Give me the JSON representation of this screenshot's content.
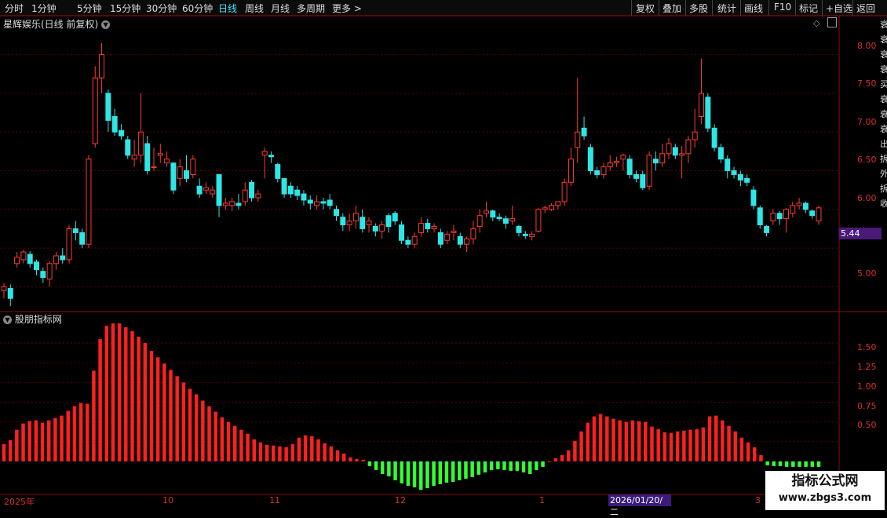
{
  "toolbar": {
    "periods": [
      "分时",
      "1分钟",
      "5分钟",
      "15分钟",
      "30分钟",
      "60分钟",
      "日线",
      "周线",
      "月线",
      "多周期",
      "更多 >"
    ],
    "active_period": "日线",
    "actions": [
      "复权",
      "叠加",
      "多股",
      "统计",
      "画线",
      "F10",
      "标记",
      "+自选",
      "返回"
    ]
  },
  "chart": {
    "title": "星辉娱乐(日线 前复权)",
    "indicator_title": "股朋指标网",
    "price_ticks": [
      "8.00",
      "7.50",
      "7.00",
      "6.50",
      "6.00",
      "5.00"
    ],
    "last_price_tag": "5.44",
    "indicator_ticks": [
      "1.50",
      "1.25",
      "1.00",
      "0.75",
      "0.50"
    ],
    "dates": [
      "2025年",
      "10",
      "11",
      "12",
      "1",
      "3"
    ],
    "highlighted_date": "2026/01/20/二",
    "colors": {
      "up": "#ff3b30",
      "down": "#2ee6e6",
      "macd_up": "#ff2020",
      "macd_down": "#33ff33",
      "grid": "#5a0000"
    }
  },
  "right_strip": "衰衰衰衰买衰衰衰出拆外拆收",
  "watermark": {
    "line1": "指标公式网",
    "line2": "www.zbgs3.com"
  },
  "chart_data": {
    "type": "candlestick",
    "title": "星辉娱乐(日线 前复权)",
    "price_range": [
      4.7,
      8.3
    ],
    "candles": [
      [
        4.95,
        5.0,
        4.85,
        5.05
      ],
      [
        4.98,
        4.85,
        4.75,
        5.03
      ],
      [
        5.3,
        5.38,
        5.25,
        5.45
      ],
      [
        5.35,
        5.45,
        5.3,
        5.48
      ],
      [
        5.42,
        5.3,
        5.25,
        5.46
      ],
      [
        5.32,
        5.22,
        5.15,
        5.35
      ],
      [
        5.2,
        5.12,
        5.05,
        5.25
      ],
      [
        5.1,
        5.3,
        5.0,
        5.33
      ],
      [
        5.3,
        5.4,
        5.22,
        5.45
      ],
      [
        5.4,
        5.35,
        5.3,
        5.5
      ],
      [
        5.35,
        5.75,
        5.3,
        5.8
      ],
      [
        5.75,
        5.7,
        5.6,
        5.85
      ],
      [
        5.7,
        5.55,
        5.5,
        5.75
      ],
      [
        5.55,
        6.65,
        5.5,
        6.7
      ],
      [
        6.85,
        7.7,
        6.8,
        7.85
      ],
      [
        7.7,
        8.0,
        7.5,
        8.15
      ],
      [
        7.5,
        7.15,
        7.0,
        7.55
      ],
      [
        7.2,
        7.0,
        6.95,
        7.3
      ],
      [
        7.02,
        6.95,
        6.9,
        7.1
      ],
      [
        6.9,
        6.7,
        6.65,
        6.95
      ],
      [
        6.65,
        6.7,
        6.55,
        6.9
      ],
      [
        6.7,
        7.0,
        6.6,
        7.5
      ],
      [
        6.85,
        6.5,
        6.45,
        6.95
      ],
      [
        6.55,
        6.55,
        6.5,
        6.8
      ],
      [
        6.7,
        6.72,
        6.6,
        6.85
      ],
      [
        6.6,
        6.65,
        6.55,
        6.75
      ],
      [
        6.6,
        6.25,
        6.2,
        6.6
      ],
      [
        6.4,
        6.55,
        6.3,
        6.65
      ],
      [
        6.5,
        6.4,
        6.35,
        6.7
      ],
      [
        6.45,
        6.65,
        6.4,
        6.7
      ],
      [
        6.3,
        6.2,
        6.15,
        6.4
      ],
      [
        6.25,
        6.28,
        6.2,
        6.35
      ],
      [
        6.2,
        6.25,
        6.15,
        6.3
      ],
      [
        6.45,
        6.05,
        5.9,
        6.45
      ],
      [
        6.05,
        6.08,
        6.0,
        6.15
      ],
      [
        6.05,
        6.1,
        5.98,
        6.15
      ],
      [
        6.08,
        6.05,
        6.0,
        6.2
      ],
      [
        6.1,
        6.25,
        6.05,
        6.35
      ],
      [
        6.35,
        6.15,
        6.1,
        6.38
      ],
      [
        6.15,
        6.2,
        6.1,
        6.25
      ],
      [
        6.7,
        6.75,
        6.4,
        6.8
      ],
      [
        6.7,
        6.68,
        6.6,
        6.75
      ],
      [
        6.58,
        6.4,
        6.35,
        6.6
      ],
      [
        6.4,
        6.2,
        6.15,
        6.4
      ],
      [
        6.3,
        6.2,
        6.15,
        6.35
      ],
      [
        6.25,
        6.18,
        6.12,
        6.3
      ],
      [
        6.2,
        6.12,
        6.05,
        6.25
      ],
      [
        6.12,
        6.08,
        6.0,
        6.18
      ],
      [
        6.05,
        6.1,
        6.0,
        6.18
      ],
      [
        6.1,
        6.08,
        6.0,
        6.15
      ],
      [
        6.12,
        6.05,
        6.0,
        6.2
      ],
      [
        6.0,
        5.92,
        5.85,
        6.05
      ],
      [
        5.9,
        5.8,
        5.72,
        5.95
      ],
      [
        5.8,
        5.85,
        5.72,
        5.95
      ],
      [
        5.85,
        5.95,
        5.75,
        6.05
      ],
      [
        5.9,
        5.75,
        5.7,
        6.0
      ],
      [
        5.8,
        5.85,
        5.7,
        5.9
      ],
      [
        5.78,
        5.72,
        5.65,
        5.82
      ],
      [
        5.72,
        5.8,
        5.62,
        5.85
      ],
      [
        5.92,
        5.78,
        5.7,
        5.95
      ],
      [
        5.95,
        5.85,
        5.8,
        5.98
      ],
      [
        5.8,
        5.6,
        5.55,
        5.85
      ],
      [
        5.6,
        5.55,
        5.5,
        5.65
      ],
      [
        5.55,
        5.65,
        5.5,
        5.7
      ],
      [
        5.7,
        5.82,
        5.65,
        5.9
      ],
      [
        5.82,
        5.75,
        5.7,
        5.88
      ],
      [
        5.75,
        5.78,
        5.7,
        5.82
      ],
      [
        5.7,
        5.55,
        5.5,
        5.75
      ],
      [
        5.6,
        5.68,
        5.55,
        5.72
      ],
      [
        5.7,
        5.72,
        5.6,
        5.8
      ],
      [
        5.65,
        5.55,
        5.5,
        5.7
      ],
      [
        5.55,
        5.62,
        5.45,
        5.65
      ],
      [
        5.62,
        5.75,
        5.55,
        5.85
      ],
      [
        5.78,
        5.92,
        5.7,
        6.0
      ],
      [
        5.95,
        5.98,
        5.9,
        6.1
      ],
      [
        5.98,
        5.9,
        5.85,
        6.0
      ],
      [
        5.9,
        5.88,
        5.85,
        5.95
      ],
      [
        5.88,
        5.82,
        5.75,
        5.92
      ],
      [
        5.85,
        5.88,
        5.8,
        6.05
      ],
      [
        5.78,
        5.7,
        5.65,
        5.8
      ],
      [
        5.68,
        5.66,
        5.62,
        5.72
      ],
      [
        5.65,
        5.68,
        5.6,
        5.72
      ],
      [
        5.72,
        6.0,
        5.7,
        6.02
      ],
      [
        6.0,
        6.02,
        5.95,
        6.05
      ],
      [
        6.0,
        6.05,
        5.98,
        6.08
      ],
      [
        6.05,
        6.1,
        6.0,
        6.1
      ],
      [
        6.1,
        6.35,
        6.05,
        6.4
      ],
      [
        6.35,
        6.65,
        6.3,
        6.8
      ],
      [
        6.8,
        7.0,
        6.6,
        7.7
      ],
      [
        7.05,
        6.95,
        6.9,
        7.2
      ],
      [
        6.8,
        6.5,
        6.45,
        6.85
      ],
      [
        6.5,
        6.45,
        6.4,
        6.55
      ],
      [
        6.45,
        6.55,
        6.4,
        6.6
      ],
      [
        6.55,
        6.6,
        6.5,
        6.7
      ],
      [
        6.6,
        6.62,
        6.55,
        6.68
      ],
      [
        6.65,
        6.7,
        6.5,
        6.72
      ],
      [
        6.65,
        6.45,
        6.4,
        6.7
      ],
      [
        6.45,
        6.4,
        6.35,
        6.5
      ],
      [
        6.45,
        6.28,
        6.25,
        6.5
      ],
      [
        6.3,
        6.7,
        6.25,
        6.75
      ],
      [
        6.65,
        6.6,
        6.5,
        6.75
      ],
      [
        6.6,
        6.72,
        6.55,
        6.85
      ],
      [
        6.72,
        6.85,
        6.65,
        6.92
      ],
      [
        6.8,
        6.7,
        6.65,
        6.85
      ],
      [
        6.7,
        6.72,
        6.4,
        6.82
      ],
      [
        6.72,
        6.9,
        6.6,
        6.95
      ],
      [
        6.9,
        7.0,
        6.8,
        7.3
      ],
      [
        7.2,
        7.5,
        7.1,
        7.95
      ],
      [
        7.45,
        7.05,
        7.0,
        7.5
      ],
      [
        7.05,
        6.8,
        6.75,
        7.1
      ],
      [
        6.8,
        6.65,
        6.6,
        6.85
      ],
      [
        6.65,
        6.5,
        6.4,
        6.7
      ],
      [
        6.5,
        6.45,
        6.4,
        6.55
      ],
      [
        6.45,
        6.38,
        6.3,
        6.5
      ],
      [
        6.4,
        6.35,
        6.3,
        6.45
      ],
      [
        6.25,
        6.05,
        6.0,
        6.3
      ],
      [
        6.02,
        5.8,
        5.75,
        6.05
      ],
      [
        5.78,
        5.7,
        5.65,
        5.8
      ],
      [
        5.85,
        5.95,
        5.8,
        6.0
      ],
      [
        5.95,
        5.88,
        5.8,
        5.98
      ],
      [
        5.88,
        6.0,
        5.7,
        6.02
      ],
      [
        5.95,
        6.05,
        5.9,
        6.1
      ],
      [
        6.05,
        6.08,
        6.0,
        6.15
      ],
      [
        6.08,
        6.0,
        5.95,
        6.1
      ],
      [
        5.98,
        5.92,
        5.88,
        6.0
      ],
      [
        5.85,
        6.02,
        5.8,
        6.05
      ]
    ],
    "macd": [
      0.22,
      0.27,
      0.4,
      0.48,
      0.51,
      0.52,
      0.49,
      0.52,
      0.55,
      0.58,
      0.64,
      0.7,
      0.74,
      0.73,
      1.15,
      1.55,
      1.72,
      1.75,
      1.75,
      1.7,
      1.65,
      1.58,
      1.5,
      1.4,
      1.32,
      1.24,
      1.16,
      1.08,
      1.0,
      0.92,
      0.85,
      0.77,
      0.7,
      0.63,
      0.56,
      0.5,
      0.45,
      0.4,
      0.35,
      0.28,
      0.24,
      0.21,
      0.2,
      0.19,
      0.18,
      0.22,
      0.3,
      0.33,
      0.32,
      0.28,
      0.23,
      0.19,
      0.14,
      0.1,
      0.05,
      0.03,
      0.02,
      -0.06,
      -0.11,
      -0.16,
      -0.19,
      -0.24,
      -0.28,
      -0.31,
      -0.33,
      -0.36,
      -0.34,
      -0.31,
      -0.29,
      -0.27,
      -0.26,
      -0.24,
      -0.22,
      -0.2,
      -0.17,
      -0.14,
      -0.11,
      -0.1,
      -0.11,
      -0.12,
      -0.12,
      -0.14,
      -0.16,
      -0.11,
      -0.07,
      0.0,
      0.04,
      0.08,
      0.14,
      0.26,
      0.38,
      0.49,
      0.57,
      0.6,
      0.57,
      0.54,
      0.52,
      0.5,
      0.52,
      0.51,
      0.5,
      0.44,
      0.41,
      0.37,
      0.36,
      0.38,
      0.39,
      0.4,
      0.41,
      0.43,
      0.57,
      0.58,
      0.52,
      0.45,
      0.38,
      0.3,
      0.24,
      0.18,
      0.08,
      -0.05,
      -0.06,
      -0.06,
      -0.07,
      -0.07,
      -0.07,
      -0.07,
      -0.07,
      -0.07
    ],
    "macd_range": [
      -0.4,
      1.82
    ]
  }
}
